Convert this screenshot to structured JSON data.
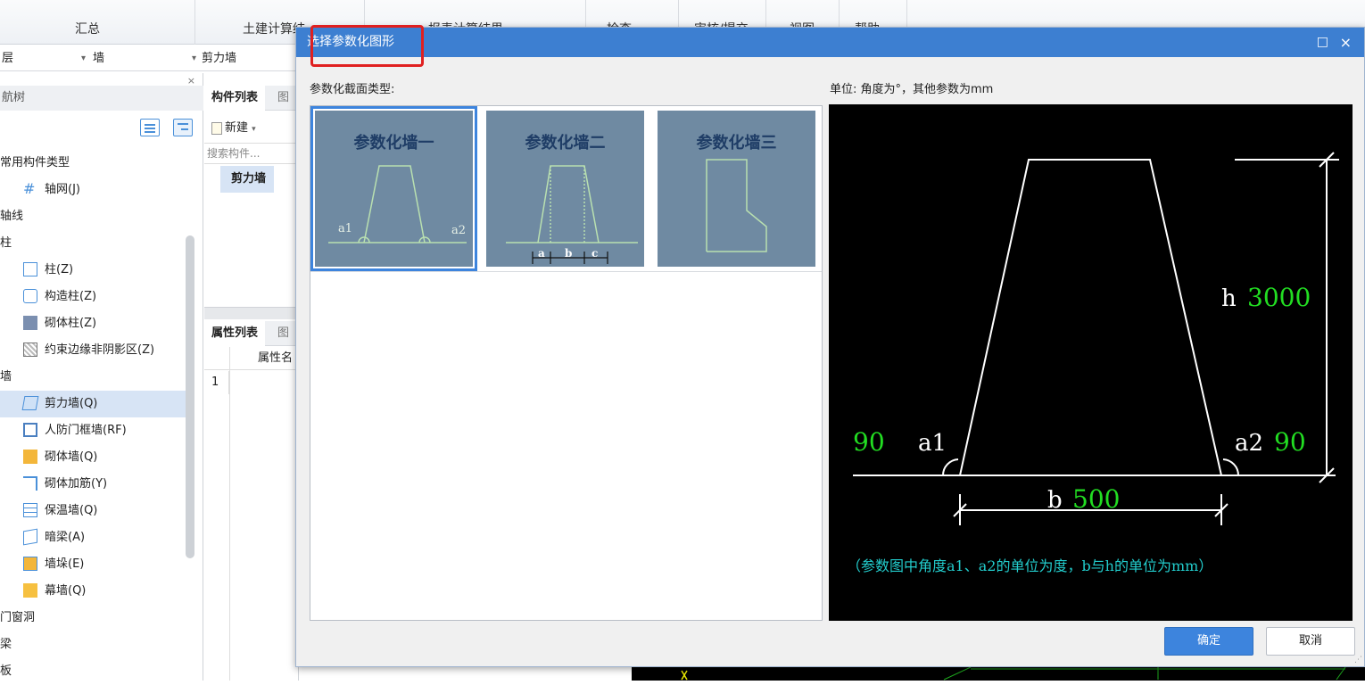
{
  "ribbon": {
    "tabs": [
      "汇总",
      "土建计算结",
      "报表计算结果",
      "检查",
      "审核/提交",
      "视图",
      "帮助"
    ]
  },
  "selectors": {
    "floor": "层",
    "category": "墙",
    "type": "剪力墙"
  },
  "left_panel": {
    "title": "航树",
    "close": "×",
    "tree": [
      {
        "kind": "cat",
        "label": "常用构件类型"
      },
      {
        "kind": "leaf",
        "label": "轴网(J)",
        "icon": "grid-icon"
      },
      {
        "kind": "cat",
        "label": "轴线"
      },
      {
        "kind": "cat",
        "label": "柱"
      },
      {
        "kind": "leaf",
        "label": "柱(Z)",
        "icon": "column-icon"
      },
      {
        "kind": "leaf",
        "label": "构造柱(Z)",
        "icon": "constructional-column-icon"
      },
      {
        "kind": "leaf",
        "label": "砌体柱(Z)",
        "icon": "masonry-column-icon"
      },
      {
        "kind": "leaf",
        "label": "约束边缘非阴影区(Z)",
        "icon": "restraint-edge-icon"
      },
      {
        "kind": "cat",
        "label": "墙"
      },
      {
        "kind": "leaf",
        "label": "剪力墙(Q)",
        "icon": "shear-wall-icon",
        "selected": true
      },
      {
        "kind": "leaf",
        "label": "人防门框墙(RF)",
        "icon": "civil-defense-door-wall-icon"
      },
      {
        "kind": "leaf",
        "label": "砌体墙(Q)",
        "icon": "masonry-wall-icon"
      },
      {
        "kind": "leaf",
        "label": "砌体加筋(Y)",
        "icon": "masonry-reinforcement-icon"
      },
      {
        "kind": "leaf",
        "label": "保温墙(Q)",
        "icon": "insulation-wall-icon"
      },
      {
        "kind": "leaf",
        "label": "暗梁(A)",
        "icon": "hidden-beam-icon"
      },
      {
        "kind": "leaf",
        "label": "墙垛(E)",
        "icon": "wall-pier-icon"
      },
      {
        "kind": "leaf",
        "label": "幕墙(Q)",
        "icon": "curtain-wall-icon"
      },
      {
        "kind": "cat",
        "label": "门窗洞"
      },
      {
        "kind": "cat",
        "label": "梁"
      },
      {
        "kind": "cat",
        "label": "板"
      }
    ]
  },
  "mid_panel": {
    "component_tab": "构件列表",
    "component_tab2": "图",
    "new_label": "新建",
    "search_placeholder": "搜索构件...",
    "component_item": "剪力墙",
    "props_tab": "属性列表",
    "props_tab2": "图",
    "props_col": "属性名",
    "row_num": "1"
  },
  "dialog": {
    "title": "选择参数化图形",
    "maximize": "□",
    "close": "×",
    "section_label": "参数化截面类型:",
    "unit_label": "单位:  角度为°，其他参数为mm",
    "ok": "确定",
    "cancel": "取消",
    "thumbnails": [
      {
        "title": "参数化墙一",
        "a1": "a1",
        "a2": "a2"
      },
      {
        "title": "参数化墙二",
        "a": "a",
        "b": "b",
        "c": "c"
      },
      {
        "title": "参数化墙三"
      }
    ],
    "preview": {
      "h_label": "h",
      "h_value": "3000",
      "a1_label": "a1",
      "a1_value": "90",
      "a2_label": "a2",
      "a2_value": "90",
      "b_label": "b",
      "b_value": "500",
      "note": "（参数图中角度a1、a2的单位为度，b与h的单位为mm）",
      "colors": {
        "lines": "#ffffff",
        "values": "#22dd22",
        "note": "#22cccc"
      }
    }
  }
}
